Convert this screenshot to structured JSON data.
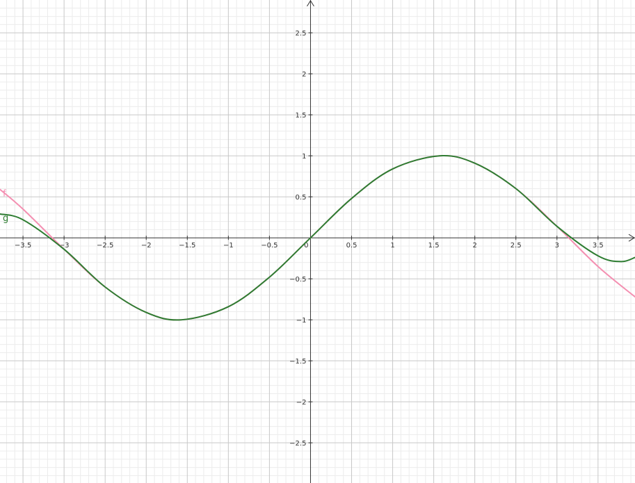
{
  "chart_data": {
    "type": "line",
    "title": "",
    "xlabel": "",
    "ylabel": "",
    "xlim": [
      -3.78,
      3.95
    ],
    "ylim": [
      -2.99,
      2.9
    ],
    "grid": true,
    "x_ticks": [
      {
        "value": -3.5,
        "label": "−3.5"
      },
      {
        "value": -3,
        "label": "−3"
      },
      {
        "value": -2.5,
        "label": "−2.5"
      },
      {
        "value": -2,
        "label": "−2"
      },
      {
        "value": -1.5,
        "label": "−1.5"
      },
      {
        "value": -1,
        "label": "−1"
      },
      {
        "value": -0.5,
        "label": "−0.5"
      },
      {
        "value": 0.5,
        "label": "0.5"
      },
      {
        "value": 1,
        "label": "1"
      },
      {
        "value": 1.5,
        "label": "1.5"
      },
      {
        "value": 2,
        "label": "2"
      },
      {
        "value": 2.5,
        "label": "2.5"
      },
      {
        "value": 3,
        "label": "3"
      },
      {
        "value": 3.5,
        "label": "3.5"
      }
    ],
    "y_ticks": [
      {
        "value": 2.5,
        "label": "2.5"
      },
      {
        "value": 2,
        "label": "2"
      },
      {
        "value": 1.5,
        "label": "1.5"
      },
      {
        "value": 1,
        "label": "1"
      },
      {
        "value": 0.5,
        "label": "0.5"
      },
      {
        "value": -0.5,
        "label": "−0.5"
      },
      {
        "value": -1,
        "label": "−1"
      },
      {
        "value": -1.5,
        "label": "−1.5"
      },
      {
        "value": -2,
        "label": "−2"
      },
      {
        "value": -2.5,
        "label": "−2.5"
      }
    ],
    "origin_label": "0",
    "series": [
      {
        "name": "f",
        "color": "#f48fb1",
        "x": [
          -3.78,
          -3.5,
          -3.0,
          -2.5,
          -2.0,
          -1.57,
          -1.0,
          -0.5,
          0,
          0.5,
          1.0,
          1.57,
          2.0,
          2.5,
          3.0,
          3.5,
          3.95
        ],
        "y": [
          0.59,
          0.35,
          -0.14,
          -0.6,
          -0.91,
          -1.0,
          -0.84,
          -0.48,
          0,
          0.48,
          0.84,
          1.0,
          0.91,
          0.6,
          0.14,
          -0.35,
          -0.72
        ]
      },
      {
        "name": "g",
        "color": "#2e7d32",
        "x": [
          -3.78,
          -3.5,
          -3.0,
          -2.5,
          -2.0,
          -1.57,
          -1.0,
          -0.5,
          0,
          0.5,
          1.0,
          1.57,
          2.0,
          2.5,
          3.0,
          3.5,
          3.78,
          3.95
        ],
        "y": [
          0.29,
          0.22,
          -0.14,
          -0.6,
          -0.91,
          -1.0,
          -0.84,
          -0.48,
          0,
          0.48,
          0.84,
          1.0,
          0.91,
          0.6,
          0.14,
          -0.22,
          -0.29,
          -0.24
        ]
      }
    ]
  }
}
